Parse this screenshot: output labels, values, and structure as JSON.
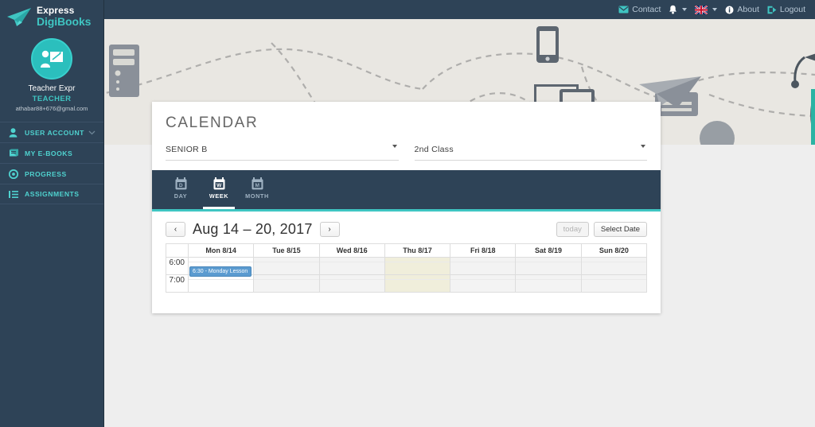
{
  "brand": {
    "logo_line1": "Express",
    "logo_line2": "DigiBooks",
    "plane_icon": "paper-plane-icon",
    "accent_teal": "#3fc5c2",
    "navy": "#2e4357"
  },
  "topbar": {
    "contact": "Contact",
    "contact_icon": "envelope-icon",
    "bell_icon": "bell-icon",
    "flag_icon": "uk-flag-icon",
    "about": "About",
    "about_icon": "info-circle-icon",
    "logout": "Logout",
    "logout_icon": "sign-out-icon"
  },
  "sidebar": {
    "avatar_icon": "teacher-avatar-icon",
    "user_name": "Teacher Expr",
    "user_role": "TEACHER",
    "user_email": "athabar88+676@gmal.com",
    "items": [
      {
        "label": "USER ACCOUNT",
        "icon": "user-icon",
        "has_chevron": true
      },
      {
        "label": "MY E-BOOKS",
        "icon": "book-icon",
        "has_chevron": false
      },
      {
        "label": "PROGRESS",
        "icon": "progress-circle-icon",
        "has_chevron": false
      },
      {
        "label": "ASSIGNMENTS",
        "icon": "list-icon",
        "has_chevron": false
      }
    ]
  },
  "card": {
    "title": "CALENDAR",
    "selectors": [
      {
        "name": "level-select",
        "value": "SENIOR B"
      },
      {
        "name": "class-select",
        "value": "2nd Class"
      }
    ],
    "tabs": [
      {
        "label": "DAY",
        "glyph": "D",
        "active": false
      },
      {
        "label": "WEEK",
        "glyph": "W",
        "active": true
      },
      {
        "label": "MONTH",
        "glyph": "M",
        "active": false
      }
    ],
    "toolbar": {
      "prev": "‹",
      "next": "›",
      "range_title": "Aug 14 – 20, 2017",
      "today_label": "today",
      "today_disabled": true,
      "select_date_label": "Select Date"
    },
    "grid": {
      "day_headers": [
        "Mon 8/14",
        "Tue 8/15",
        "Wed 8/16",
        "Thu 8/17",
        "Fri 8/18",
        "Sat 8/19",
        "Sun 8/20"
      ],
      "time_labels": [
        "6:00",
        "7:00"
      ],
      "today_column_index": 3,
      "business_column_index": 0,
      "events": [
        {
          "label": "6:30 - Monday Lesson",
          "day_index": 0,
          "row_index": 0,
          "color": "#5b9bd0"
        }
      ]
    }
  },
  "hero": {
    "owl_icon": "owl-graduate-icon",
    "envelope_icon": "envelope-circle-icon",
    "devices": [
      "server-icon",
      "smartphone-icon",
      "laptop-icon",
      "tablet-icon",
      "paper-plane-icon"
    ]
  }
}
